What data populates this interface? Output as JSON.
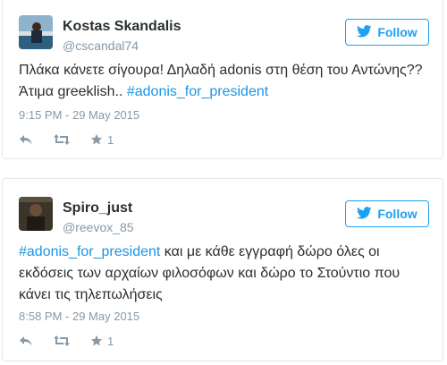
{
  "tweets": [
    {
      "name": "Kostas Skandalis",
      "handle": "@cscandal74",
      "follow_label": "Follow",
      "text_line1": "Πλάκα κάνετε σίγουρα! Δηλαδή adonis στη θέση του Αντώνης??",
      "text_line2_prefix": "Άτιμα greeklish.. ",
      "hashtag": "#adonis_for_president",
      "time": "9:15 PM - 29 May 2015",
      "favorites": "1"
    },
    {
      "name": "Spiro_just",
      "handle": "@reevox_85",
      "follow_label": "Follow",
      "hashtag": "#adonis_for_president",
      "text_line1_suffix": " και με κάθε εγγραφή δώρο όλες οι",
      "text_line2": "εκδόσεις των αρχαίων φιλοσόφων και δώρο το Στούντιο που",
      "text_line3": "κάνει τις τηλεπωλήσεις",
      "time": "8:58 PM - 29 May 2015",
      "favorites": "1"
    }
  ],
  "colors": {
    "accent": "#1da1f2",
    "hashtag": "#1b95e0",
    "muted": "#8899a6",
    "text": "#292f33",
    "border": "#e1e8ed"
  }
}
